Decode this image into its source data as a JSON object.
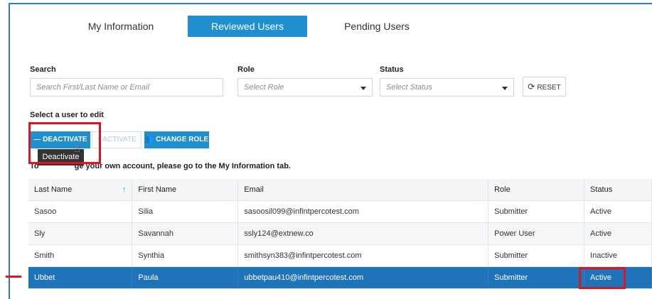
{
  "tabs": [
    {
      "label": "My Information"
    },
    {
      "label": "Reviewed Users"
    },
    {
      "label": "Pending Users"
    }
  ],
  "filters": {
    "search_label": "Search",
    "search_placeholder": "Search First/Last Name or Email",
    "role_label": "Role",
    "role_placeholder": "Select Role",
    "status_label": "Status",
    "status_placeholder": "Select Status",
    "reset_label": "RESET"
  },
  "actions": {
    "title": "Select a user to edit",
    "deactivate": "DEACTIVATE",
    "activate": "ACTIVATE",
    "change_role": "CHANGE ROLE",
    "tooltip": "Deactivate"
  },
  "note": {
    "prefix": "To",
    "text": "ge your own account, please go to the My Information tab."
  },
  "table": {
    "headers": [
      "Last Name",
      "First Name",
      "Email",
      "Role",
      "Status"
    ],
    "sort_icon": "↑",
    "rows": [
      {
        "last": "Sasoo",
        "first": "Silia",
        "email": "sasoosil099@infintpercotest.com",
        "role": "Submitter",
        "status": "Active"
      },
      {
        "last": "Sly",
        "first": "Savannah",
        "email": "ssly124@extnew.co",
        "role": "Power User",
        "status": "Active"
      },
      {
        "last": "Smith",
        "first": "Synthia",
        "email": "smithsyn383@infintpercotest.com",
        "role": "Submitter",
        "status": "Inactive"
      },
      {
        "last": "Ubbet",
        "first": "Paula",
        "email": "ubbetpau410@infintpercotest.com",
        "role": "Submitter",
        "status": "Active"
      }
    ]
  },
  "colors": {
    "accent": "#1f8fd0",
    "selected_row": "#1f73b8",
    "highlight": "#e0141f"
  }
}
